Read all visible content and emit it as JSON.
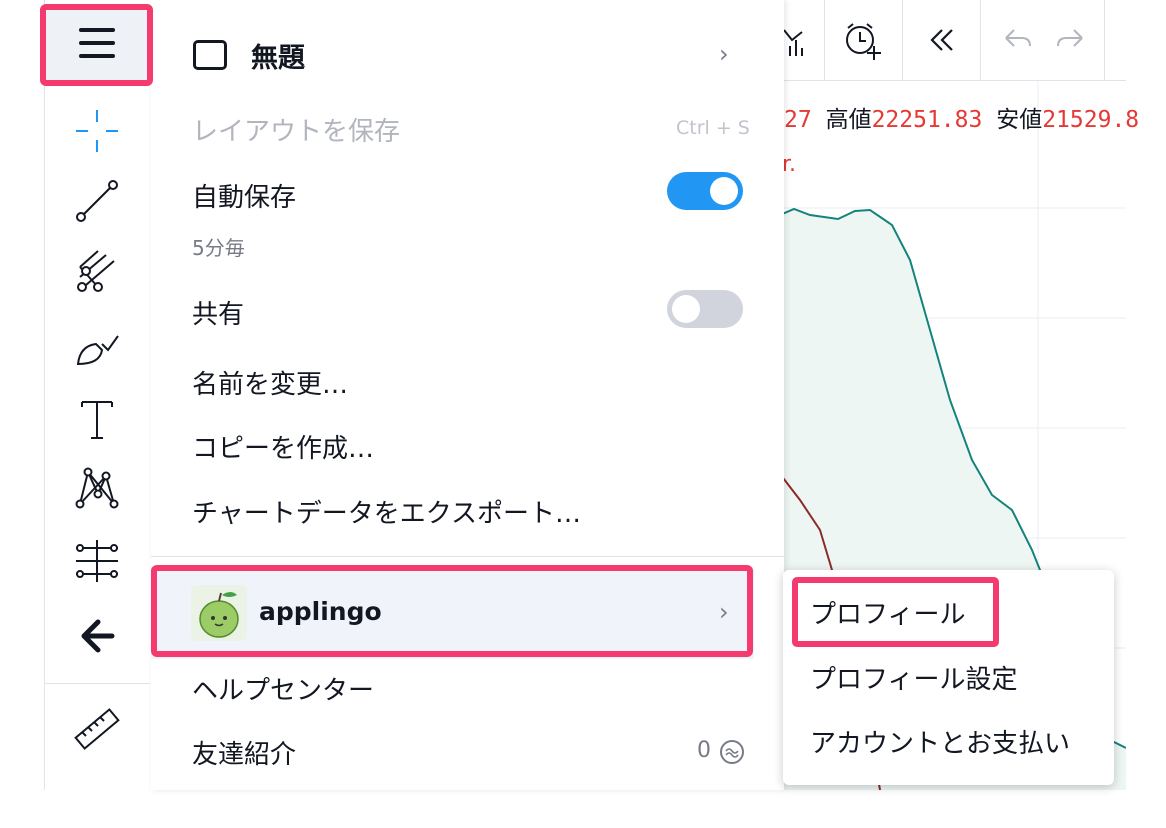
{
  "layout": {
    "title": "無題",
    "items": {
      "save_layout": "レイアウトを保存",
      "save_shortcut": "Ctrl + S",
      "autosave": "自動保存",
      "autosave_interval": "5分毎",
      "autosave_enabled": true,
      "share": "共有",
      "share_enabled": false,
      "rename": "名前を変更…",
      "make_copy": "コピーを作成…",
      "export_data": "チャートデータをエクスポート…"
    }
  },
  "user": {
    "name": "applingo",
    "menu": {
      "help_center": "ヘルプセンター",
      "refer_friend": "友達紹介",
      "refer_count": "0"
    }
  },
  "submenu": {
    "profile": "プロフィール",
    "profile_settings": "プロフィール設定",
    "account_billing": "アカウントとお支払い"
  },
  "chart_legend": {
    "prev_fragment": "27",
    "high_label": "高値",
    "high_value": "22251.83",
    "low_label": "安値",
    "low_value": "21529.8",
    "sub_fragment": "r."
  },
  "colors": {
    "accent_blue": "#2962ff",
    "toggle_on": "#2196f3",
    "toggle_off": "#d1d4dc",
    "highlight": "#f43a6e",
    "series_teal": "#13837b",
    "series_red": "#8b2a2a",
    "legend_value_red": "#e53935"
  },
  "icons": [
    "menu-icon",
    "crosshair-icon",
    "trend-line-icon",
    "pitchfork-icon",
    "brush-icon",
    "text-icon",
    "pattern-icon",
    "measure-icon",
    "back-arrow-icon",
    "ruler-icon",
    "bar-chart-icon",
    "alert-icon",
    "rewind-icon",
    "undo-icon",
    "redo-icon",
    "chevron-right-icon"
  ]
}
